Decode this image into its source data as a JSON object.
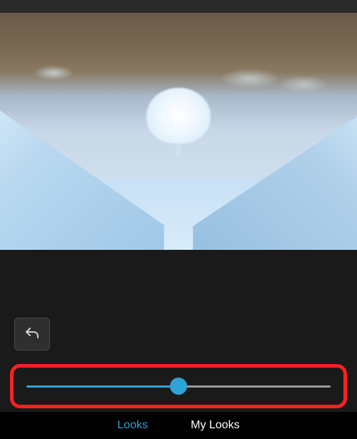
{
  "tabs": {
    "looks": "Looks",
    "myLooks": "My Looks",
    "activeTab": "looks"
  },
  "slider": {
    "position": 50
  },
  "controls": {
    "undo": "undo"
  },
  "highlight": {
    "target": "slider",
    "color": "#ff2020"
  },
  "colors": {
    "accent": "#2ea3d6",
    "background": "#1a1a1a",
    "panel": "#2a2a2a"
  }
}
